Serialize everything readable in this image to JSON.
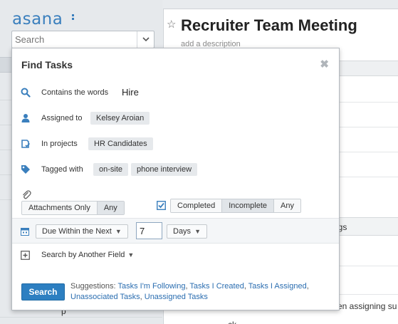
{
  "app": {
    "logo": "asana",
    "search_placeholder": "Search"
  },
  "task": {
    "title": "Recruiter Team Meeting",
    "description_placeholder": "add a description",
    "section_fragment": "ngs",
    "row_fragment_1": "en assigning su",
    "row_fragment_2": "ck",
    "left_fragment": "p"
  },
  "dialog": {
    "title": "Find Tasks",
    "close_glyph": "✖",
    "contains_label": "Contains the words",
    "contains_value": "Hire",
    "assigned_label": "Assigned to",
    "assigned_value": "Kelsey Aroian",
    "projects_label": "In projects",
    "projects_value": "HR Candidates",
    "tagged_label": "Tagged with",
    "tags": [
      "on-site",
      "phone interview"
    ],
    "attachments_options": [
      "Attachments Only",
      "Any"
    ],
    "completion_options": [
      "Completed",
      "Incomplete",
      "Any"
    ],
    "due_mode": "Due Within the Next",
    "due_number": "7",
    "due_unit": "Days",
    "another_field": "Search by Another Field",
    "search_button": "Search",
    "suggestions_label": "Suggestions:",
    "suggestions": [
      "Tasks I'm Following",
      "Tasks I Created",
      "Tasks I Assigned",
      "Unassociated Tasks",
      "Unassigned Tasks"
    ]
  },
  "colors": {
    "accent": "#2d7fc1",
    "logo": "#3a7fbd",
    "icon": "#3a7fbd",
    "link": "#2a6db0"
  }
}
